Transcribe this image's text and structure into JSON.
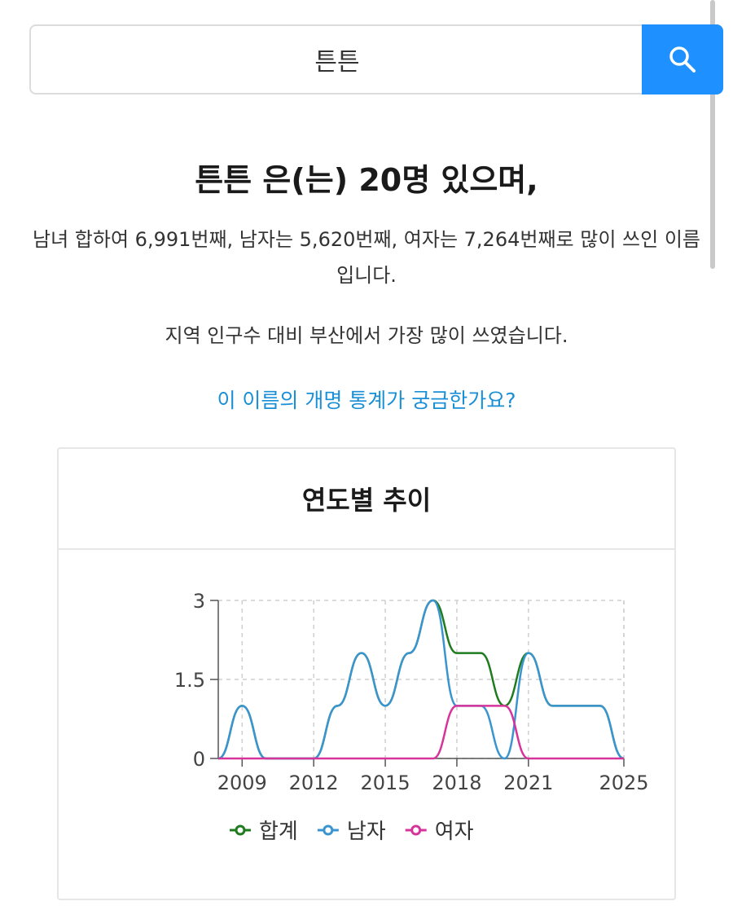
{
  "search": {
    "value": "튼튼"
  },
  "result": {
    "headline": "튼튼 은(는) 20명 있으며,",
    "description": "남녀 합하여 6,991번째, 남자는 5,620번째, 여자는 7,264번째로 많이 쓰인 이름입니다.",
    "region_text": "지역 인구수 대비 부산에서 가장 많이 쓰였습니다.",
    "rename_link": "이 이름의 개명 통계가 궁금한가요?"
  },
  "chart_card": {
    "title": "연도별 추이"
  },
  "colors": {
    "accent": "#1e90ff",
    "link": "#1a8fd6",
    "total": "#1e7b1e",
    "male": "#3a94cf",
    "female": "#d6349b"
  },
  "chart_data": {
    "type": "line",
    "x": [
      2008,
      2009,
      2010,
      2011,
      2012,
      2013,
      2014,
      2015,
      2016,
      2017,
      2018,
      2019,
      2020,
      2021,
      2022,
      2023,
      2024,
      2025
    ],
    "xticks": [
      "2009",
      "2012",
      "2015",
      "2018",
      "2021",
      "2025"
    ],
    "ytick_labels": [
      "0",
      "1.5",
      "3"
    ],
    "ylim": [
      0,
      3
    ],
    "grid": true,
    "legend_position": "bottom",
    "series": [
      {
        "name": "합계",
        "color": "#1e7b1e",
        "values": [
          0,
          1,
          0,
          0,
          0,
          1,
          2,
          1,
          2,
          3,
          2,
          2,
          1,
          2,
          1,
          1,
          1,
          0
        ]
      },
      {
        "name": "남자",
        "color": "#3a94cf",
        "values": [
          0,
          1,
          0,
          0,
          0,
          1,
          2,
          1,
          2,
          3,
          1,
          1,
          0,
          2,
          1,
          1,
          1,
          0
        ]
      },
      {
        "name": "여자",
        "color": "#d6349b",
        "values": [
          0,
          0,
          0,
          0,
          0,
          0,
          0,
          0,
          0,
          0,
          1,
          1,
          1,
          0,
          0,
          0,
          0,
          0
        ]
      }
    ]
  }
}
